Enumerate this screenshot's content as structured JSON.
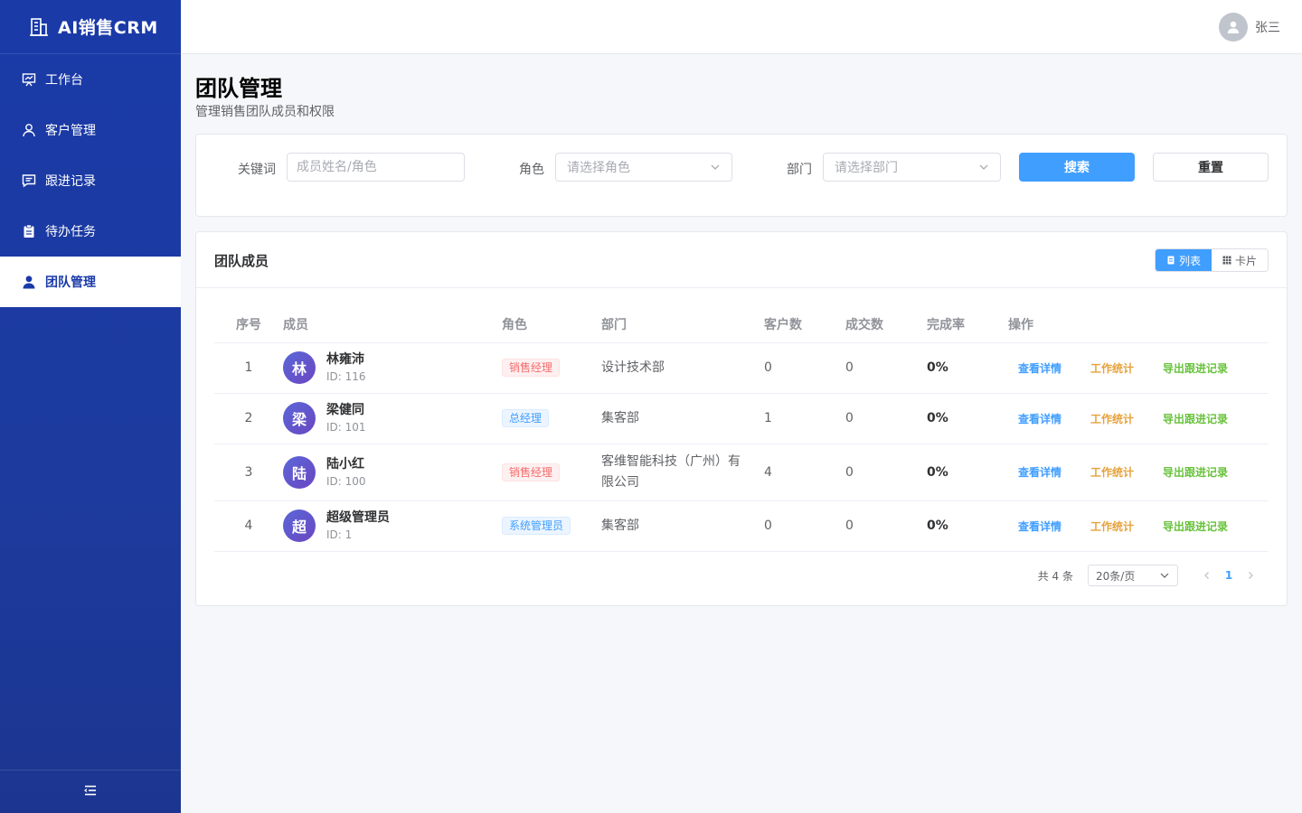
{
  "app": {
    "title": "AI销售CRM"
  },
  "sidebar": {
    "items": [
      {
        "label": "工作台",
        "icon": "presentation-icon"
      },
      {
        "label": "客户管理",
        "icon": "user-outline-icon"
      },
      {
        "label": "跟进记录",
        "icon": "message-icon"
      },
      {
        "label": "待办任务",
        "icon": "clipboard-icon"
      },
      {
        "label": "团队管理",
        "icon": "user-solid-icon",
        "active": true
      }
    ],
    "collapse_icon": "menu-collapse-icon"
  },
  "header": {
    "username": "张三"
  },
  "page": {
    "title": "团队管理",
    "subtitle": "管理销售团队成员和权限"
  },
  "filters": {
    "keyword_label": "关键词",
    "keyword_placeholder": "成员姓名/角色",
    "role_label": "角色",
    "role_placeholder": "请选择角色",
    "dept_label": "部门",
    "dept_placeholder": "请选择部门",
    "search_label": "搜索",
    "reset_label": "重置"
  },
  "team": {
    "title": "团队成员",
    "view_list": "列表",
    "view_card": "卡片",
    "columns": [
      "序号",
      "成员",
      "角色",
      "部门",
      "客户数",
      "成交数",
      "完成率",
      "操作"
    ],
    "rows": [
      {
        "idx": "1",
        "avatar": "林",
        "name": "林雍沛",
        "id": "ID: 116",
        "role": "销售经理",
        "dept": "设计技术部",
        "customers": "0",
        "deals": "0",
        "rate": "0%"
      },
      {
        "idx": "2",
        "avatar": "梁",
        "name": "梁健同",
        "id": "ID: 101",
        "role": "总经理",
        "dept": "集客部",
        "customers": "1",
        "deals": "0",
        "rate": "0%"
      },
      {
        "idx": "3",
        "avatar": "陆",
        "name": "陆小红",
        "id": "ID: 100",
        "role": "销售经理",
        "dept": "客维智能科技（广州）有限公司",
        "customers": "4",
        "deals": "0",
        "rate": "0%"
      },
      {
        "idx": "4",
        "avatar": "超",
        "name": "超级管理员",
        "id": "ID: 1",
        "role": "系统管理员",
        "dept": "集客部",
        "customers": "0",
        "deals": "0",
        "rate": "0%"
      }
    ],
    "actions": {
      "view": "查看详情",
      "stats": "工作统计",
      "export": "导出跟进记录"
    }
  },
  "pagination": {
    "total": "共 4 条",
    "page_size": "20条/页",
    "current": "1"
  },
  "colors": {
    "sidebar": "#1a3aa8",
    "primary": "#409eff",
    "danger": "#f56c6c",
    "warning": "#e6a23c",
    "success": "#67c23a"
  }
}
